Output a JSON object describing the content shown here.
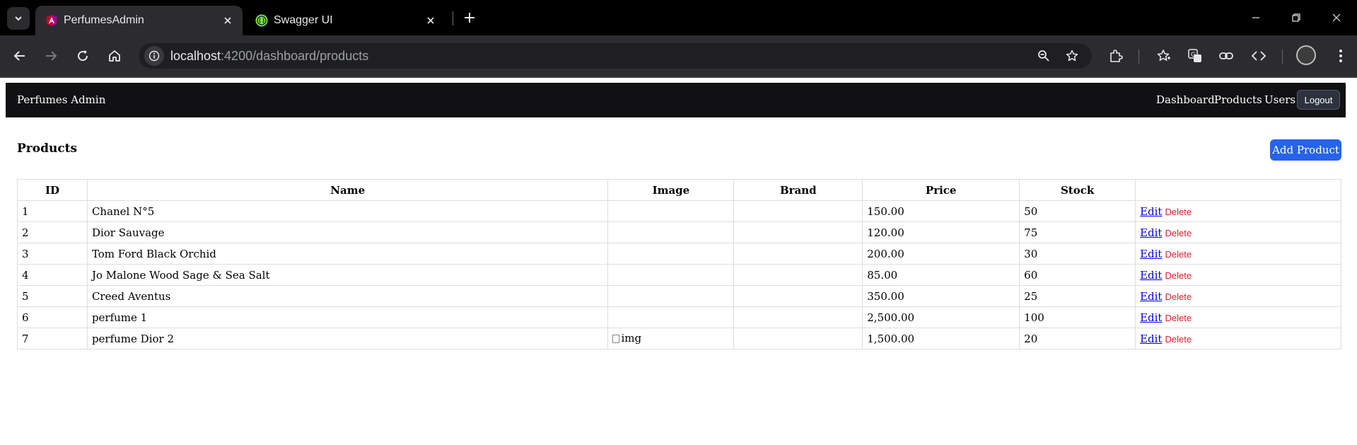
{
  "browser": {
    "tabs": [
      {
        "title": "PerfumesAdmin",
        "active": true,
        "favicon": "angular-icon"
      },
      {
        "title": "Swagger UI",
        "active": false,
        "favicon": "swagger-icon"
      }
    ],
    "url_host": "localhost",
    "url_path": ":4200/dashboard/products",
    "colors": {
      "chrome_bg": "#000000",
      "toolbar_bg": "#2c2c30",
      "omnibox_bg": "#1f1f22"
    }
  },
  "app": {
    "brand": "Perfumes Admin",
    "nav": {
      "dashboard": "Dashboard",
      "products": "Products",
      "users": "Users",
      "logout": "Logout"
    },
    "colors": {
      "navbar_bg": "#111114",
      "accent": "#2563eb",
      "delete": "#e11d2a"
    }
  },
  "page": {
    "title": "Products",
    "add_button": "Add Product"
  },
  "table": {
    "headers": [
      "ID",
      "Name",
      "Image",
      "Brand",
      "Price",
      "Stock",
      ""
    ],
    "rows": [
      {
        "id": "1",
        "name": "Chanel N°5",
        "image": "",
        "brand": "",
        "price": "150.00",
        "stock": "50",
        "edit": "Edit",
        "delete": "Delete"
      },
      {
        "id": "2",
        "name": "Dior Sauvage",
        "image": "",
        "brand": "",
        "price": "120.00",
        "stock": "75",
        "edit": "Edit",
        "delete": "Delete"
      },
      {
        "id": "3",
        "name": "Tom Ford Black Orchid",
        "image": "",
        "brand": "",
        "price": "200.00",
        "stock": "30",
        "edit": "Edit",
        "delete": "Delete"
      },
      {
        "id": "4",
        "name": "Jo Malone Wood Sage & Sea Salt",
        "image": "",
        "brand": "",
        "price": "85.00",
        "stock": "60",
        "edit": "Edit",
        "delete": "Delete"
      },
      {
        "id": "5",
        "name": "Creed Aventus",
        "image": "",
        "brand": "",
        "price": "350.00",
        "stock": "25",
        "edit": "Edit",
        "delete": "Delete"
      },
      {
        "id": "6",
        "name": "perfume 1",
        "image": "",
        "brand": "",
        "price": "2,500.00",
        "stock": "100",
        "edit": "Edit",
        "delete": "Delete"
      },
      {
        "id": "7",
        "name": "perfume Dior 2",
        "image": "img",
        "brand": "",
        "price": "1,500.00",
        "stock": "20",
        "edit": "Edit",
        "delete": "Delete"
      }
    ]
  }
}
